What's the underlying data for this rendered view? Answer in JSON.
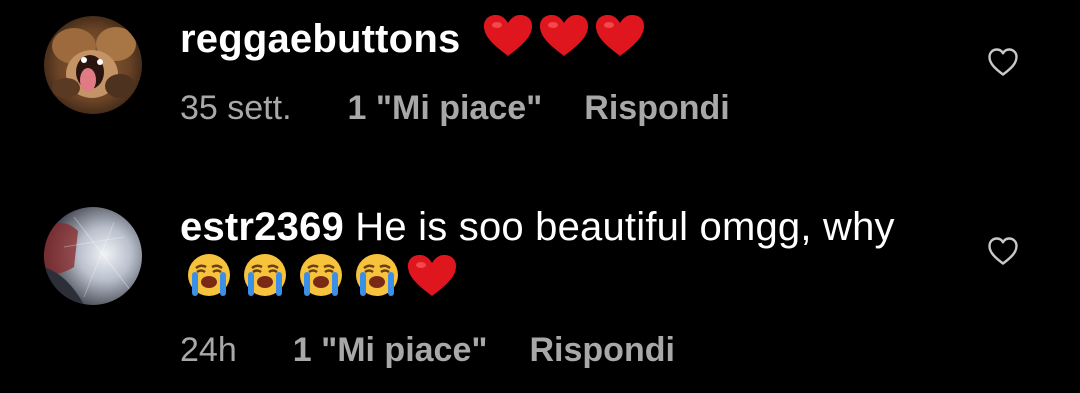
{
  "comments": [
    {
      "username": "reggaebuttons",
      "text": "",
      "emojis": [
        "red-heart",
        "red-heart",
        "red-heart"
      ],
      "time": "35 sett.",
      "likes": "1 \"Mi piace\"",
      "reply": "Rispondi",
      "like_icon": "heart-outline-icon"
    },
    {
      "username": "estr2369",
      "text": "He is soo beautiful omgg, why",
      "emojis": [
        "loudly-crying-face",
        "loudly-crying-face",
        "loudly-crying-face",
        "loudly-crying-face",
        "red-heart"
      ],
      "time": "24h",
      "likes": "1 \"Mi piace\"",
      "reply": "Rispondi",
      "like_icon": "heart-outline-icon"
    }
  ],
  "colors": {
    "background": "#000000",
    "primary_text": "#ffffff",
    "secondary_text": "#a8a8a8",
    "heart_emoji": "#e0161e",
    "crying_face": "#f7c23c",
    "tears": "#3b8fe6"
  }
}
